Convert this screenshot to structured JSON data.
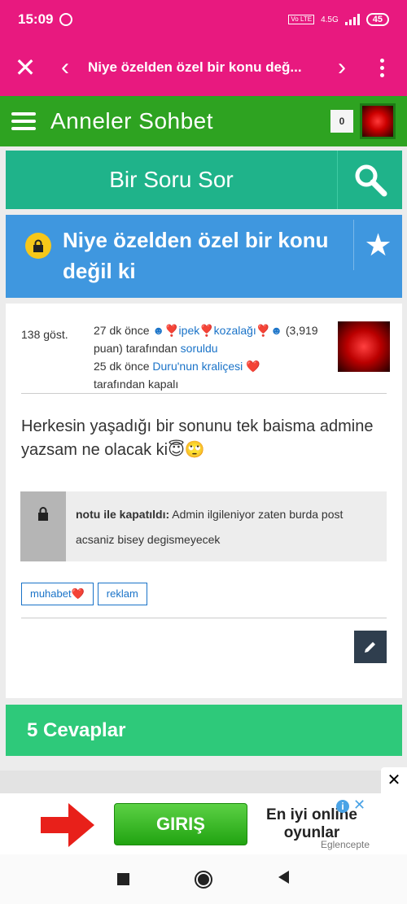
{
  "status_bar": {
    "time": "15:09",
    "network": "4.5G",
    "volte": "Vo LTE",
    "battery": "45"
  },
  "title_bar": {
    "title": "Niye özelden özel bir konu değ..."
  },
  "site_header": {
    "brand": "Anneler Sohbet",
    "notification_count": "0"
  },
  "ask_bar": {
    "label": "Bir Soru Sor"
  },
  "question": {
    "title": "Niye özelden özel bir konu değil ki",
    "views": "138 göst.",
    "asked_time": "27 dk önce",
    "asker_name": "☻❣️ipek❣️kozalağı❣️☻",
    "asker_points": "(3,919 puan)",
    "asked_by_text": "tarafından",
    "asked_action": "soruldu",
    "closed_time": "25 dk önce",
    "closer_name": "Duru'nun kraliçesi",
    "closer_heart": "❤️",
    "closed_by_text": "tarafından kapalı",
    "body": "Herkesin yaşadığı bir sonunu tek baisma admine yazsam ne olacak ki😇🙄",
    "close_note_label": "notu ile kapatıldı:",
    "close_note_text": "Admin ilgileniyor zaten burda post acsaniz bisey degismeyecek",
    "tags": [
      "muhabet❤️",
      "reklam"
    ]
  },
  "answers_header": {
    "label": "5 Cevaplar"
  },
  "ad": {
    "button_label": "GIRIŞ",
    "title": "En iyi online oyunlar",
    "sponsor": "Eglencepte",
    "close_label": "✕"
  },
  "colors": {
    "status_bar": "#e8197f",
    "site_header": "#2ea321",
    "ask_bar": "#1fb38a",
    "question_header": "#3f97df",
    "answers_header": "#2ec97a",
    "link": "#1a73c8"
  }
}
